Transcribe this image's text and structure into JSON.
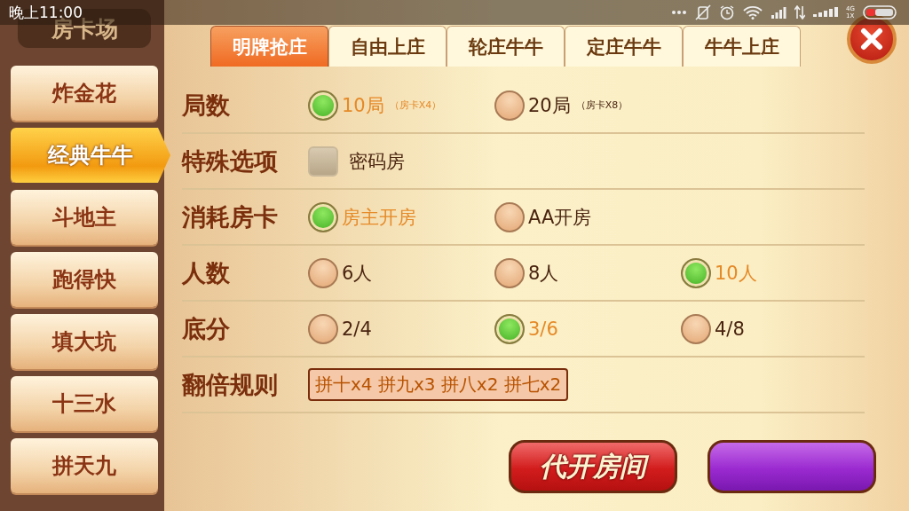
{
  "status_bar": {
    "time": "晚上11:00",
    "network_top": "4G",
    "network_bottom": "1X"
  },
  "sidebar": {
    "title": "房卡场",
    "items": [
      {
        "label": "炸金花",
        "selected": false
      },
      {
        "label": "经典牛牛",
        "selected": true
      },
      {
        "label": "斗地主",
        "selected": false
      },
      {
        "label": "跑得快",
        "selected": false
      },
      {
        "label": "填大坑",
        "selected": false
      },
      {
        "label": "十三水",
        "selected": false
      },
      {
        "label": "拼天九",
        "selected": false
      }
    ]
  },
  "tabs": [
    {
      "label": "明牌抢庄",
      "selected": true
    },
    {
      "label": "自由上庄",
      "selected": false
    },
    {
      "label": "轮庄牛牛",
      "selected": false
    },
    {
      "label": "定庄牛牛",
      "selected": false
    },
    {
      "label": "牛牛上庄",
      "selected": false
    }
  ],
  "rows": [
    {
      "label": "局数",
      "kind": "radio",
      "options": [
        {
          "text": "10局",
          "note": "（房卡X4）",
          "selected": true
        },
        {
          "text": "20局",
          "note": "（房卡X8）",
          "selected": false
        }
      ]
    },
    {
      "label": "特殊选项",
      "kind": "checkbox",
      "options": [
        {
          "text": "密码房",
          "checked": false
        }
      ]
    },
    {
      "label": "消耗房卡",
      "kind": "radio",
      "options": [
        {
          "text": "房主开房",
          "selected": true
        },
        {
          "text": "AA开房",
          "selected": false
        }
      ]
    },
    {
      "label": "人数",
      "kind": "radio",
      "options": [
        {
          "text": "6人",
          "selected": false
        },
        {
          "text": "8人",
          "selected": false
        },
        {
          "text": "10人",
          "selected": true
        }
      ]
    },
    {
      "label": "底分",
      "kind": "radio",
      "options": [
        {
          "text": "2/4",
          "selected": false
        },
        {
          "text": "3/6",
          "selected": true
        },
        {
          "text": "4/8",
          "selected": false
        }
      ]
    },
    {
      "label": "翻倍规则",
      "kind": "tag",
      "value": "拼十x4 拼九x3 拼八x2 拼七x2"
    }
  ],
  "buttons": [
    {
      "label": "代开房间",
      "kind": "primary"
    },
    {
      "kind": "secondary"
    }
  ]
}
